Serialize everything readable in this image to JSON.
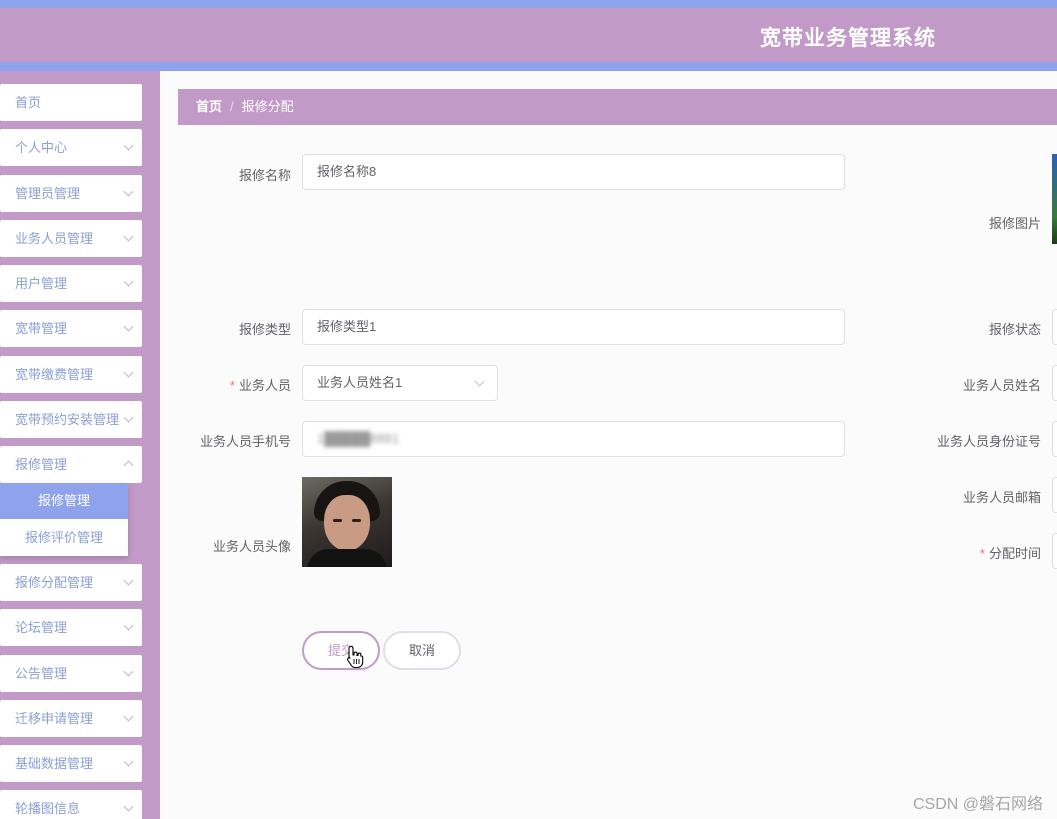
{
  "header": {
    "title": "宽带业务管理系统"
  },
  "sidebar": {
    "items": [
      {
        "label": "首页",
        "has_chevron": false
      },
      {
        "label": "个人中心",
        "has_chevron": true
      },
      {
        "label": "管理员管理",
        "has_chevron": true
      },
      {
        "label": "业务人员管理",
        "has_chevron": true
      },
      {
        "label": "用户管理",
        "has_chevron": true
      },
      {
        "label": "宽带管理",
        "has_chevron": true
      },
      {
        "label": "宽带缴费管理",
        "has_chevron": true
      },
      {
        "label": "宽带预约安装管理",
        "has_chevron": true
      },
      {
        "label": "报修管理",
        "has_chevron": true,
        "expanded": true
      },
      {
        "label": "报修分配管理",
        "has_chevron": true
      },
      {
        "label": "论坛管理",
        "has_chevron": true
      },
      {
        "label": "公告管理",
        "has_chevron": true
      },
      {
        "label": "迁移申请管理",
        "has_chevron": true
      },
      {
        "label": "基础数据管理",
        "has_chevron": true
      },
      {
        "label": "轮播图信息",
        "has_chevron": true
      }
    ],
    "submenu": [
      {
        "label": "报修管理",
        "active": true
      },
      {
        "label": "报修评价管理",
        "active": false
      }
    ]
  },
  "breadcrumb": {
    "home": "首页",
    "separator": "/",
    "current": "报修分配"
  },
  "form": {
    "repair_name": {
      "label": "报修名称",
      "value": "报修名称8"
    },
    "repair_image": {
      "label": "报修图片"
    },
    "repair_type": {
      "label": "报修类型",
      "value": "报修类型1"
    },
    "repair_status": {
      "label": "报修状态"
    },
    "staff": {
      "label": "业务人员",
      "required_mark": "*",
      "value": "业务人员姓名1"
    },
    "staff_name": {
      "label": "业务人员姓名"
    },
    "staff_phone": {
      "label": "业务人员手机号",
      "value": "1█████8881"
    },
    "staff_id_card": {
      "label": "业务人员身份证号"
    },
    "staff_email": {
      "label": "业务人员邮箱"
    },
    "staff_avatar": {
      "label": "业务人员头像"
    },
    "assign_time": {
      "label": "分配时间",
      "required_mark": "*"
    }
  },
  "buttons": {
    "submit": "提交",
    "cancel": "取消"
  },
  "watermark": "CSDN @磐石网络",
  "colors": {
    "primary": "#c29ac8",
    "accent": "#8fa3ec",
    "required": "#f56c6c"
  }
}
